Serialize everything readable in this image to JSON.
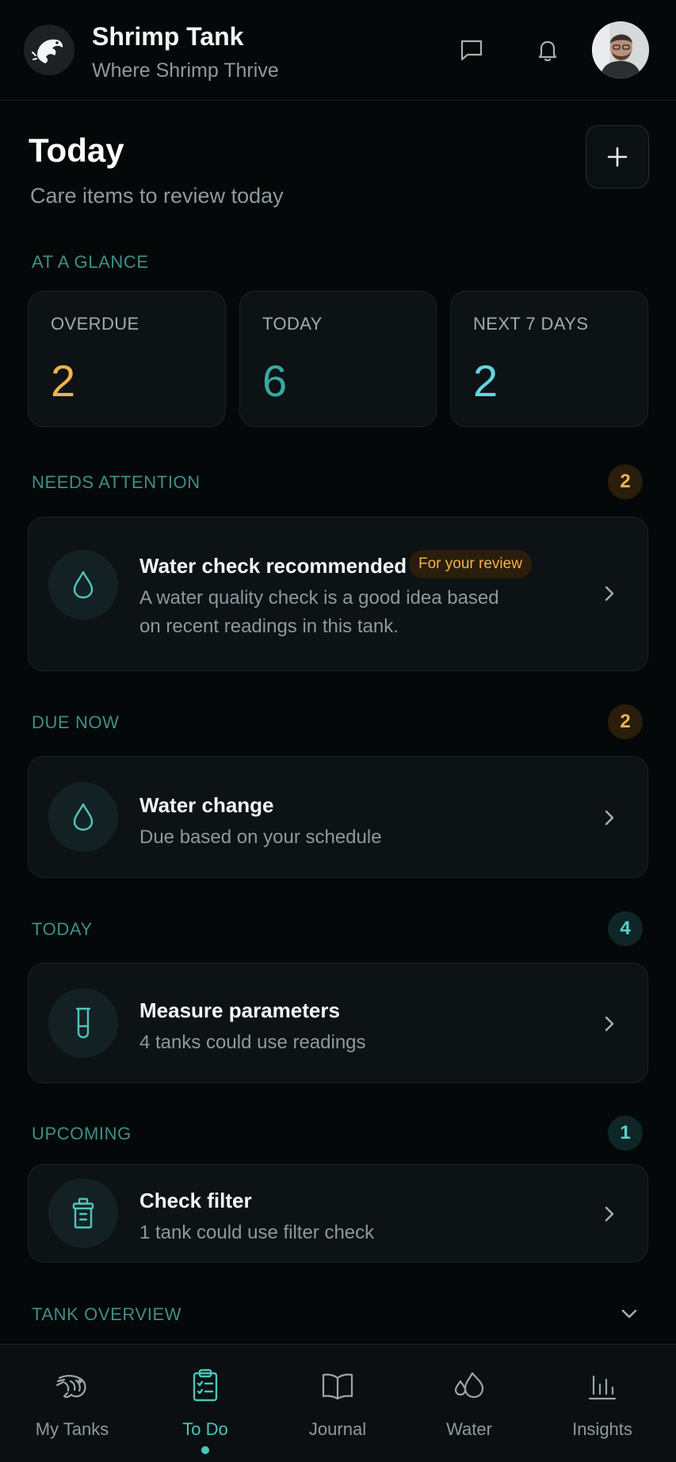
{
  "app": {
    "title": "Shrimp Tank",
    "subtitle": "Where Shrimp Thrive"
  },
  "page": {
    "title": "Today",
    "subtitle": "Care items to review today"
  },
  "glance": {
    "label": "AT A GLANCE",
    "cards": [
      {
        "label": "OVERDUE",
        "value": "2",
        "color": "#f2b24d"
      },
      {
        "label": "TODAY",
        "value": "6",
        "color": "#3aa89f"
      },
      {
        "label": "NEXT 7 DAYS",
        "value": "2",
        "color": "#5fd8e0"
      }
    ]
  },
  "sections": {
    "attention": {
      "label": "NEEDS ATTENTION",
      "count": "2",
      "item": {
        "title": "Water check recommended",
        "pill": "For your review",
        "desc1": "A water quality check is a good idea based",
        "desc2": "on recent readings in this tank.",
        "icon": "water-drop-icon"
      }
    },
    "due_now": {
      "label": "DUE NOW",
      "count": "2",
      "item": {
        "title": "Water change",
        "desc": "Due based on your schedule",
        "icon": "water-drop-icon"
      }
    },
    "today": {
      "label": "TODAY",
      "count": "4",
      "item": {
        "title": "Measure parameters",
        "desc": "4 tanks could use readings",
        "icon": "test-tube-icon"
      }
    },
    "upcoming": {
      "label": "UPCOMING",
      "count": "1",
      "item": {
        "title": "Check filter",
        "desc": "1 tank could use filter check",
        "icon": "filter-icon"
      }
    },
    "overview": {
      "label": "TANK OVERVIEW"
    }
  },
  "nav": [
    {
      "label": "My Tanks",
      "icon": "shrimp-icon"
    },
    {
      "label": "To Do",
      "icon": "clipboard-icon",
      "active": true
    },
    {
      "label": "Journal",
      "icon": "book-icon"
    },
    {
      "label": "Water",
      "icon": "water-drops-icon"
    },
    {
      "label": "Insights",
      "icon": "bar-chart-icon"
    }
  ],
  "colors": {
    "accent": "#47c7bd",
    "warning": "#f2b24d",
    "background": "#050809"
  }
}
